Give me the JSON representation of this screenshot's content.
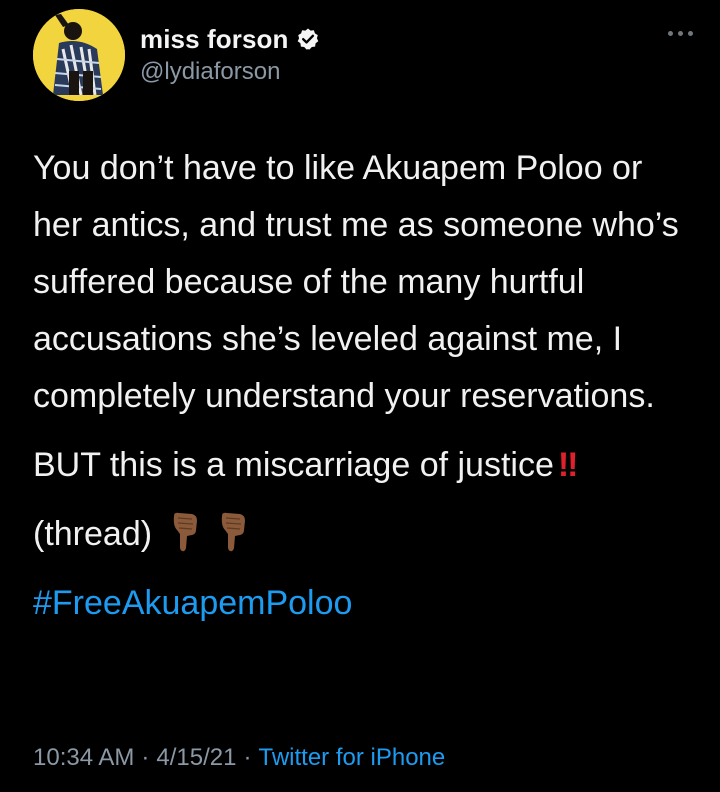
{
  "tweet": {
    "author": {
      "display_name": "miss forson",
      "handle": "@lydiaforson",
      "verified": true
    },
    "more_icon": "more-horizontal-icon",
    "paragraphs": [
      "You don’t have to like Akuapem Poloo or her antics, and trust me as someone who’s suffered because of the many hurtful accusations she’s leveled against me, I completely understand your reservations.",
      "BUT this is a miscarriage of justice",
      "(thread)"
    ],
    "double_exclamation": "‼",
    "hashtag": "#FreeAkuapemPoloo",
    "time": "10:34 AM",
    "date": "4/15/21",
    "source": "Twitter for iPhone",
    "separator": "·"
  },
  "colors": {
    "background": "#000000",
    "link": "#1d9bf0",
    "muted": "#8b98a5",
    "avatar_bg": "#f2d43e",
    "exclamation": "#e0202a"
  }
}
